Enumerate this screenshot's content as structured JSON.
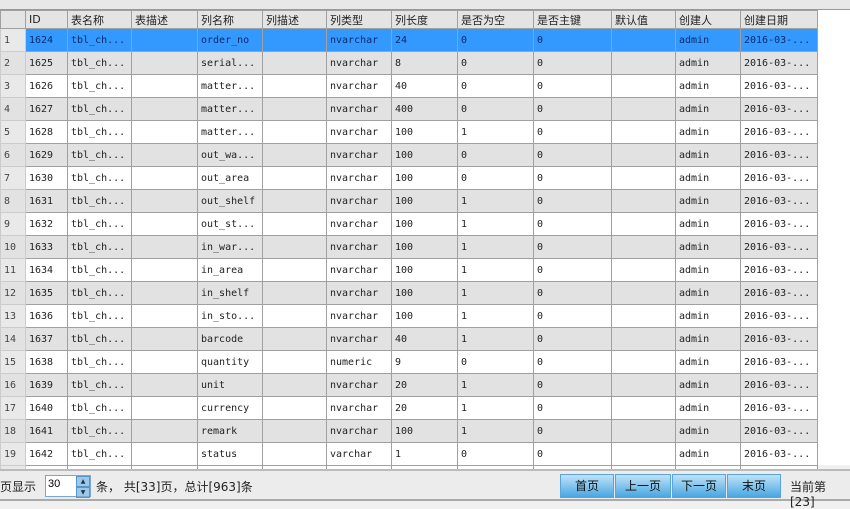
{
  "columns": [
    "",
    "ID",
    "表名称",
    "表描述",
    "列名称",
    "列描述",
    "列类型",
    "列长度",
    "是否为空",
    "是否主键",
    "默认值",
    "创建人",
    "创建日期"
  ],
  "rows": [
    [
      "1",
      "1624",
      "tbl_ch...",
      "",
      "order_no",
      "",
      "nvarchar",
      "24",
      "0",
      "0",
      "",
      "admin",
      "2016-03-..."
    ],
    [
      "2",
      "1625",
      "tbl_ch...",
      "",
      "serial...",
      "",
      "nvarchar",
      "8",
      "0",
      "0",
      "",
      "admin",
      "2016-03-..."
    ],
    [
      "3",
      "1626",
      "tbl_ch...",
      "",
      "matter...",
      "",
      "nvarchar",
      "40",
      "0",
      "0",
      "",
      "admin",
      "2016-03-..."
    ],
    [
      "4",
      "1627",
      "tbl_ch...",
      "",
      "matter...",
      "",
      "nvarchar",
      "400",
      "0",
      "0",
      "",
      "admin",
      "2016-03-..."
    ],
    [
      "5",
      "1628",
      "tbl_ch...",
      "",
      "matter...",
      "",
      "nvarchar",
      "100",
      "1",
      "0",
      "",
      "admin",
      "2016-03-..."
    ],
    [
      "6",
      "1629",
      "tbl_ch...",
      "",
      "out_wa...",
      "",
      "nvarchar",
      "100",
      "0",
      "0",
      "",
      "admin",
      "2016-03-..."
    ],
    [
      "7",
      "1630",
      "tbl_ch...",
      "",
      "out_area",
      "",
      "nvarchar",
      "100",
      "0",
      "0",
      "",
      "admin",
      "2016-03-..."
    ],
    [
      "8",
      "1631",
      "tbl_ch...",
      "",
      "out_shelf",
      "",
      "nvarchar",
      "100",
      "1",
      "0",
      "",
      "admin",
      "2016-03-..."
    ],
    [
      "9",
      "1632",
      "tbl_ch...",
      "",
      "out_st...",
      "",
      "nvarchar",
      "100",
      "1",
      "0",
      "",
      "admin",
      "2016-03-..."
    ],
    [
      "10",
      "1633",
      "tbl_ch...",
      "",
      "in_war...",
      "",
      "nvarchar",
      "100",
      "1",
      "0",
      "",
      "admin",
      "2016-03-..."
    ],
    [
      "11",
      "1634",
      "tbl_ch...",
      "",
      "in_area",
      "",
      "nvarchar",
      "100",
      "1",
      "0",
      "",
      "admin",
      "2016-03-..."
    ],
    [
      "12",
      "1635",
      "tbl_ch...",
      "",
      "in_shelf",
      "",
      "nvarchar",
      "100",
      "1",
      "0",
      "",
      "admin",
      "2016-03-..."
    ],
    [
      "13",
      "1636",
      "tbl_ch...",
      "",
      "in_sto...",
      "",
      "nvarchar",
      "100",
      "1",
      "0",
      "",
      "admin",
      "2016-03-..."
    ],
    [
      "14",
      "1637",
      "tbl_ch...",
      "",
      "barcode",
      "",
      "nvarchar",
      "40",
      "1",
      "0",
      "",
      "admin",
      "2016-03-..."
    ],
    [
      "15",
      "1638",
      "tbl_ch...",
      "",
      "quantity",
      "",
      "numeric",
      "9",
      "0",
      "0",
      "",
      "admin",
      "2016-03-..."
    ],
    [
      "16",
      "1639",
      "tbl_ch...",
      "",
      "unit",
      "",
      "nvarchar",
      "20",
      "1",
      "0",
      "",
      "admin",
      "2016-03-..."
    ],
    [
      "17",
      "1640",
      "tbl_ch...",
      "",
      "currency",
      "",
      "nvarchar",
      "20",
      "1",
      "0",
      "",
      "admin",
      "2016-03-..."
    ],
    [
      "18",
      "1641",
      "tbl_ch...",
      "",
      "remark",
      "",
      "nvarchar",
      "100",
      "1",
      "0",
      "",
      "admin",
      "2016-03-..."
    ],
    [
      "19",
      "1642",
      "tbl_ch...",
      "",
      "status",
      "",
      "varchar",
      "1",
      "0",
      "0",
      "",
      "admin",
      "2016-03-..."
    ]
  ],
  "footer": {
    "per_page_label": "每页显示",
    "page_size": "30",
    "summary": "条， 共[33]页，总计[963]条",
    "first": "首页",
    "prev": "上一页",
    "next": "下一页",
    "last": "末页",
    "current": "当前第[23]"
  }
}
